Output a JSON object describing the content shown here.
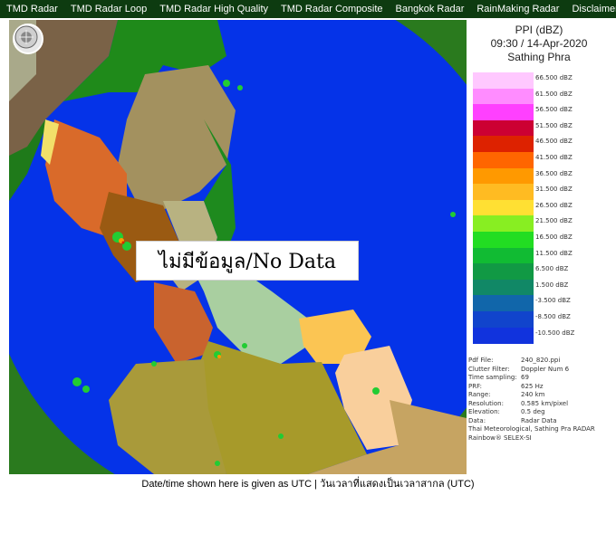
{
  "nav": {
    "items": [
      {
        "label": "TMD Radar"
      },
      {
        "label": "TMD Radar Loop"
      },
      {
        "label": "TMD Radar High Quality"
      },
      {
        "label": "TMD Radar Composite"
      },
      {
        "label": "Bangkok Radar"
      },
      {
        "label": "RainMaking Radar"
      },
      {
        "label": "Disclaimer"
      }
    ]
  },
  "radar": {
    "no_data_text": "ไม่มีข้อมูล/No Data"
  },
  "legend": {
    "title": "PPI (dBZ)",
    "datetime": "09:30 / 14-Apr-2020",
    "station": "Sathing Phra",
    "scale": [
      {
        "label": "66.500 dBZ",
        "color": "#ffc8ff"
      },
      {
        "label": "61.500 dBZ",
        "color": "#ff8cff"
      },
      {
        "label": "56.500 dBZ",
        "color": "#ff40ff"
      },
      {
        "label": "51.500 dBZ",
        "color": "#cc0033"
      },
      {
        "label": "46.500 dBZ",
        "color": "#dd2200"
      },
      {
        "label": "41.500 dBZ",
        "color": "#ff6600"
      },
      {
        "label": "36.500 dBZ",
        "color": "#ff9900"
      },
      {
        "label": "31.500 dBZ",
        "color": "#ffbb22"
      },
      {
        "label": "26.500 dBZ",
        "color": "#ffe033"
      },
      {
        "label": "21.500 dBZ",
        "color": "#88ee22"
      },
      {
        "label": "16.500 dBZ",
        "color": "#22dd22"
      },
      {
        "label": "11.500 dBZ",
        "color": "#11bb33"
      },
      {
        "label": "6.500 dBZ",
        "color": "#119944"
      },
      {
        "label": "1.500 dBZ",
        "color": "#118866"
      },
      {
        "label": "-3.500 dBZ",
        "color": "#1166aa"
      },
      {
        "label": "-8.500 dBZ",
        "color": "#1144cc"
      },
      {
        "label": "-10.500 dBZ",
        "color": "#1133dd"
      }
    ],
    "info": [
      {
        "key": "Pdf File:",
        "value": "240_820.ppi"
      },
      {
        "key": "Clutter Filter:",
        "value": "Doppler Num 6"
      },
      {
        "key": "Time sampling:",
        "value": "69"
      },
      {
        "key": "PRF:",
        "value": "625 Hz"
      },
      {
        "key": "Range:",
        "value": "240 km"
      },
      {
        "key": "Resolution:",
        "value": "0.585 km/pixel"
      },
      {
        "key": "Elevation:",
        "value": "0.5 deg"
      },
      {
        "key": "Data:",
        "value": "Radar Data"
      }
    ],
    "footer_lines": [
      "Thai Meteorological, Sathing Pra RADAR",
      "Rainbow® SELEX-SI"
    ]
  },
  "caption": "Date/time shown here is given as UTC | วันเวลาที่แสดงเป็นเวลาสากล (UTC)"
}
